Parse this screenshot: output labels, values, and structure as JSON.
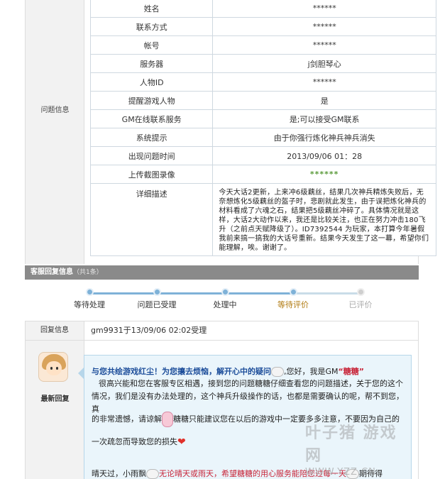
{
  "issue_info": {
    "side_label": "问题信息",
    "rows": [
      {
        "key": "姓名",
        "value": "******"
      },
      {
        "key": "联系方式",
        "value": "******"
      },
      {
        "key": "帐号",
        "value": "******"
      },
      {
        "key": "服务器",
        "value": "j剑胆琴心"
      },
      {
        "key": "人物ID",
        "value": "******"
      },
      {
        "key": "提醒游戏人物",
        "value": "是"
      },
      {
        "key": "GM在线联系服务",
        "value": "是;可以接受GM联系"
      },
      {
        "key": "系统提示",
        "value": "由于你强行炼化神兵神兵消失"
      },
      {
        "key": "出现问题时间",
        "value": "2013/09/06 01：28"
      },
      {
        "key": "上传截图录像",
        "value": "******"
      },
      {
        "key": "详细描述",
        "value": "今天大话2更新，上来冲6级藕丝，结果几次神兵精炼失败后，无奈想炼化5级藕丝的盔子时，悲剧就此发生，由于误把炼化神兵的材料看成了六魂之石，结果把5级藕丝冲碎了。具体情况就是这样，大话2大动作以来，我还是比较关注，也正在努力冲击180飞升（之前点天赋降级了）。ID7392544 为玩家，本打算今年暑假我前来搞一搞我的大话号重新。结果今天发生了这一幕，希望你们能理解，唉。谢谢了。"
      }
    ]
  },
  "service_reply": {
    "title": "客服回复信息",
    "count": "（共1条）"
  },
  "progress": {
    "steps": [
      {
        "label": "等待处理",
        "state": "done"
      },
      {
        "label": "问题已受理",
        "state": "done"
      },
      {
        "label": "处理中",
        "state": "done"
      },
      {
        "label": "等待评价",
        "state": "current"
      },
      {
        "label": "已评价",
        "state": "pending"
      }
    ]
  },
  "reply_info": {
    "label": "回复信息",
    "value": "gm9931于13/09/06 02:02受理"
  },
  "latest_reply": {
    "label": "最新回复",
    "line1_a": "与您共绘游戏红尘！为您攘去烦恼，解开心中的疑问",
    "line1_b": ",您好，我是GM",
    "line1_name": "“糖糖”",
    "para2": "很高兴能和您在客服专区相遇，接到您的问题糖糖仔细查看您的问题描述，关于您的这个情况，我们是没有办法处理的，这个神兵升级操作的话，也都是需要确认的呢，帮不到您，真",
    "para3_a": "的非常遗憾，请谅解",
    "para3_b": "糖糖只能建议您在以后的游戏中一定要多多注意，不要因为自己的",
    "para4": "一次疏忽而导致您的损失",
    "line5_a": "晴天过，小雨飘",
    "line5_b": "无论晴天或雨天，希望糖糖的用心服务能陪您过每一天",
    "line5_c": "期待得"
  },
  "watermark": {
    "brand": "叶子猪 游戏网",
    "url": "WWW.YZZ.CN"
  },
  "colors": {
    "progress_done": "#7fb2d8",
    "current_step": "#b07a10",
    "bubble_bg": "#eaf5fb",
    "header_bg": "#8a8a8a"
  }
}
